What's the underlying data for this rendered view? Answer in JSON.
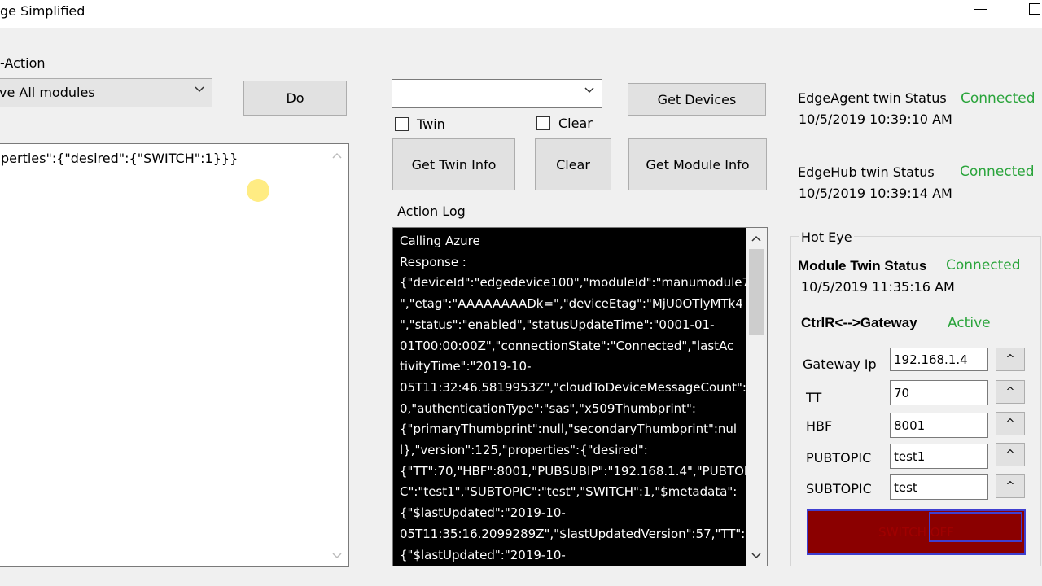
{
  "window": {
    "title": "ge Simplified"
  },
  "left": {
    "section_label": "-Action",
    "action_select": "ve All modules",
    "do_button": "Do",
    "payload_text": "perties\":{\"desired\":{\"SWITCH\":1}}}"
  },
  "center": {
    "device_select": "",
    "get_devices_button": "Get Devices",
    "twin_checkbox_label": "Twin",
    "clear_checkbox_label": "Clear",
    "get_twin_info_button": "Get Twin Info",
    "clear_button": "Clear",
    "get_module_info_button": "Get Module Info",
    "action_log_label": "Action Log",
    "log_lines": [
      "Calling Azure",
      "Response :",
      "{\"deviceId\":\"edgedevice100\",\"moduleId\":\"manumodule7",
      "\",\"etag\":\"AAAAAAAADk=\",\"deviceEtag\":\"MjU0OTlyMTk4",
      "\",\"status\":\"enabled\",\"statusUpdateTime\":\"0001-01-",
      "01T00:00:00Z\",\"connectionState\":\"Connected\",\"lastAc",
      "tivityTime\":\"2019-10-",
      "05T11:32:46.5819953Z\",\"cloudToDeviceMessageCount\":",
      "0,\"authenticationType\":\"sas\",\"x509Thumbprint\":",
      "{\"primaryThumbprint\":null,\"secondaryThumbprint\":nul",
      "l},\"version\":125,\"properties\":{\"desired\":",
      "{\"TT\":70,\"HBF\":8001,\"PUBSUBIP\":\"192.168.1.4\",\"PUBTOPI",
      "C\":\"test1\",\"SUBTOPIC\":\"test\",\"SWITCH\":1,\"$metadata\":",
      "{\"$lastUpdated\":\"2019-10-",
      "05T11:35:16.2099289Z\",\"$lastUpdatedVersion\":57,\"TT\":",
      "{\"$lastUpdated\":\"2019-10-"
    ]
  },
  "right": {
    "edgeagent": {
      "label": "EdgeAgent twin Status",
      "status": "Connected",
      "time": "10/5/2019 10:39:10 AM"
    },
    "edgehub": {
      "label": "EdgeHub twin Status",
      "status": "Connected",
      "time": "10/5/2019 10:39:14 AM"
    },
    "hot_eye": {
      "group_label": "Hot Eye",
      "module_twin_label": "Module Twin Status",
      "module_twin_status": "Connected",
      "module_twin_time": "10/5/2019 11:35:16 AM",
      "ctrl_label": "CtrlR<-->Gateway",
      "ctrl_status": "Active",
      "fields": [
        {
          "label": "Gateway Ip",
          "value": "192.168.1.4",
          "up": "^"
        },
        {
          "label": "TT",
          "value": "70",
          "up": "^"
        },
        {
          "label": "HBF",
          "value": "8001",
          "up": "^"
        },
        {
          "label": "PUBTOPIC",
          "value": "test1",
          "up": "^"
        },
        {
          "label": "SUBTOPIC",
          "value": "test",
          "up": "^"
        }
      ],
      "switch_button": "SWITCH OFF"
    }
  },
  "colors": {
    "connected": "#2aa43b",
    "switch_bg": "#8b0000",
    "log_bg": "#000000"
  }
}
